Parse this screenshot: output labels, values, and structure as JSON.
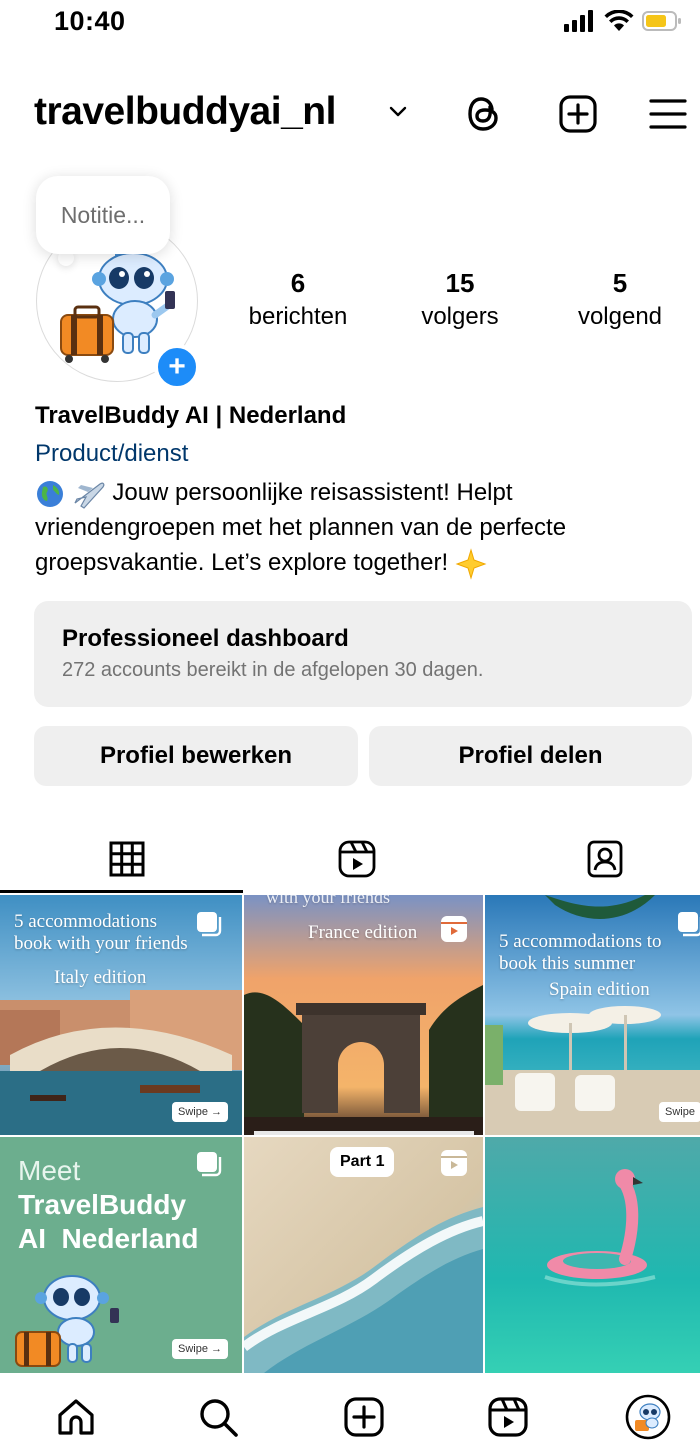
{
  "status_bar": {
    "time": "10:40"
  },
  "header": {
    "username": "travelbuddyai_nl",
    "icons": [
      "chevron-down-icon",
      "threads-icon",
      "create-plus-icon",
      "menu-icon"
    ]
  },
  "note": {
    "placeholder": "Notitie..."
  },
  "stats": [
    {
      "value": "6",
      "label": "berichten"
    },
    {
      "value": "15",
      "label": "volgers"
    },
    {
      "value": "5",
      "label": "volgend"
    }
  ],
  "bio": {
    "display_name": "TravelBuddy AI | Nederland",
    "category": "Product/dienst",
    "text_line1": "Jouw persoonlijke reisassistent! Helpt",
    "text_line2": "vriendengroepen met het plannen van de perfecte",
    "text_line3": "groepsvakantie. Let’s explore together!"
  },
  "dashboard": {
    "title": "Professioneel dashboard",
    "subtitle": "272 accounts bereikt in de afgelopen 30 dagen."
  },
  "actions": {
    "edit_label": "Profiel bewerken",
    "share_label": "Profiel delen"
  },
  "tabs": [
    "grid-icon",
    "reels-icon",
    "tagged-icon"
  ],
  "posts": [
    {
      "line1": "5 accommodations",
      "line2": "book with your friends",
      "line3": "Italy edition",
      "swipe": "Swipe →"
    },
    {
      "line1": "with your friends",
      "line2": "France edition"
    },
    {
      "line1": "5 accommodations to",
      "line2": "book this summer",
      "line3": "Spain edition",
      "swipe": "Swipe"
    },
    {
      "line1": "Meet",
      "line2": "TravelBuddy",
      "line3": "AI  Nederland",
      "swipe": "Swipe →"
    },
    {
      "label": "Part 1"
    },
    {}
  ],
  "bottom_nav": [
    "home-icon",
    "search-icon",
    "create-icon",
    "reels-icon",
    "profile-avatar"
  ],
  "colors": {
    "accent_blue": "#1d8cf8",
    "category_link": "#00376b",
    "button_bg": "#efefef",
    "secondary_text": "#737373"
  }
}
